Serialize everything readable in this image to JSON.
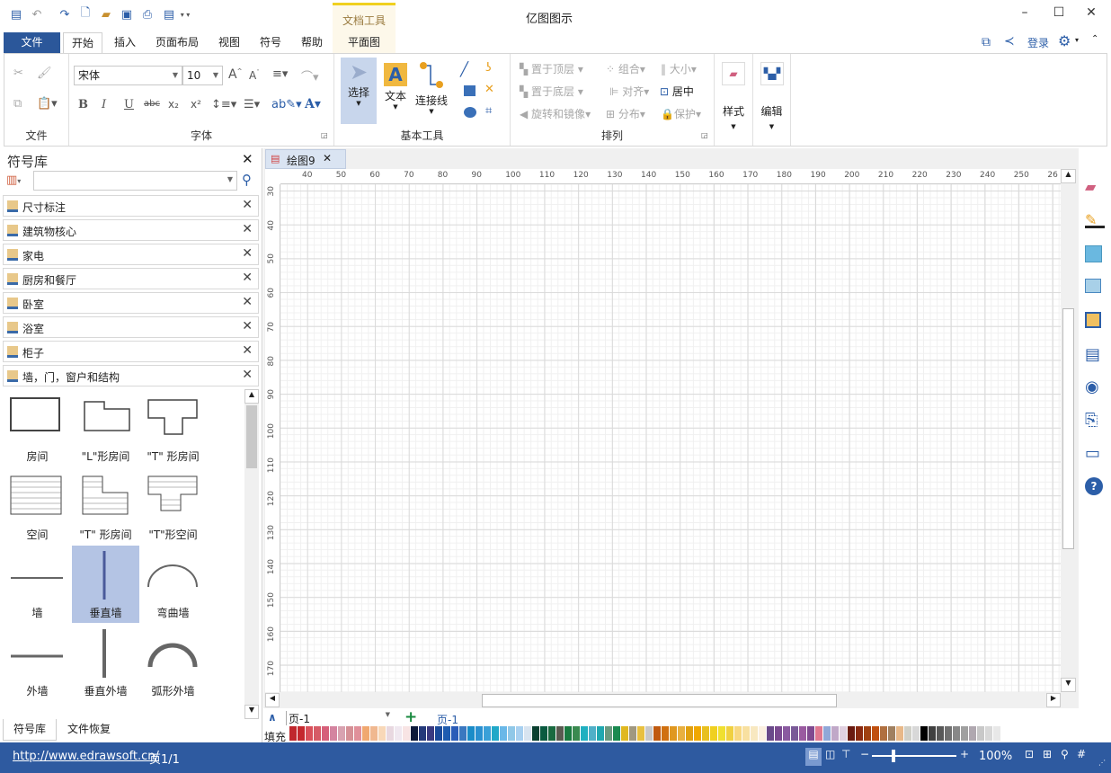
{
  "app": {
    "title": "亿图图示",
    "context_tab_group": "文档工具"
  },
  "window": {
    "minimize": "–",
    "maximize": "☐",
    "close": "✕"
  },
  "menu_tabs": [
    "文件",
    "开始",
    "插入",
    "页面布局",
    "视图",
    "符号",
    "帮助",
    "平面图"
  ],
  "header_right": {
    "login": "登录"
  },
  "ribbon": {
    "font_name": "宋体",
    "font_size": "10",
    "groups": {
      "file": "文件",
      "font": "字体",
      "basic_tools": "基本工具",
      "arrange": "排列"
    },
    "basic_tools": {
      "select": "选择",
      "text": "文本",
      "connector": "连接线"
    },
    "arrange": {
      "bring_front": "置于顶层",
      "group": "组合",
      "size": "大小",
      "send_back": "置于底层",
      "align": "对齐",
      "center": "居中",
      "rotate": "旋转和镜像",
      "distribute": "分布",
      "protect": "保护"
    },
    "style": "样式",
    "edit": "编辑"
  },
  "library": {
    "title": "符号库",
    "search_value": "",
    "items": [
      "尺寸标注",
      "建筑物核心",
      "家电",
      "厨房和餐厅",
      "卧室",
      "浴室",
      "柜子",
      "墙，门，窗户和结构"
    ],
    "shapes": [
      "房间",
      "\"L\"形房间",
      "\"T\" 形房间",
      "空间",
      "\"T\" 形房间",
      "\"T\"形空间",
      "墙",
      "垂直墙",
      "弯曲墙",
      "外墙",
      "垂直外墙",
      "弧形外墙"
    ],
    "selected_shape": "垂直墙",
    "bottom_tabs": [
      "符号库",
      "文件恢复"
    ]
  },
  "document_tab": {
    "name": "绘图9"
  },
  "ruler": {
    "top": [
      "40",
      "50",
      "60",
      "70",
      "80",
      "90",
      "100",
      "110",
      "120",
      "130",
      "140",
      "150",
      "160",
      "170",
      "180",
      "190",
      "200",
      "210",
      "220",
      "230",
      "240",
      "250",
      "26"
    ],
    "left": [
      "30",
      "40",
      "50",
      "60",
      "70",
      "80",
      "90",
      "100",
      "110",
      "120",
      "130",
      "140",
      "150",
      "160",
      "170"
    ]
  },
  "pages": {
    "selector": "页-1",
    "active_page": "页-1"
  },
  "palette": {
    "label": "填充",
    "colors": [
      "#c0272d",
      "#c4282e",
      "#d9505a",
      "#d65b66",
      "#d6607a",
      "#d484a0",
      "#d8a2b0",
      "#d59096",
      "#e0909a",
      "#f0a870",
      "#f0b890",
      "#f8d8b8",
      "#e8d8e0",
      "#f0e8f0",
      "#f8e4e4",
      "#0c1a3a",
      "#243a7a",
      "#3a3a80",
      "#1a4a9a",
      "#1e5cb0",
      "#2a5cb8",
      "#3a78c0",
      "#1a8cc8",
      "#2a90d0",
      "#3aa0d8",
      "#20a8c8",
      "#6ab8e8",
      "#90c8e8",
      "#a8d0f0",
      "#d8e4f0",
      "#0a4030",
      "#0a5a40",
      "#1a6a40",
      "#5a5a50",
      "#1a7a40",
      "#3a8a50",
      "#20b0c0",
      "#50b0c8",
      "#20a8b0",
      "#6a9a80",
      "#1a8a50",
      "#e0b820",
      "#a09880",
      "#e8c040",
      "#c8c8c8",
      "#c05a10",
      "#d07010",
      "#e09820",
      "#e8b040",
      "#e0a010",
      "#f0a800",
      "#e8c020",
      "#f0d020",
      "#f0e030",
      "#f0d040",
      "#f8d880",
      "#f8e0a0",
      "#f8e8c0",
      "#fbf0e0",
      "#6a4a8a",
      "#7a4a90",
      "#8a5aa0",
      "#7a5a98",
      "#9a5aa0",
      "#804a90",
      "#e07890",
      "#90a8d8",
      "#c0a8c8",
      "#e0d0e0",
      "#6a1a10",
      "#8a2a10",
      "#a04010",
      "#c05010",
      "#b07040",
      "#a08060",
      "#e8b888",
      "#d0d0c8",
      "#d8d8d8",
      "#000000",
      "#404040",
      "#585858",
      "#707070",
      "#888888",
      "#a0a0a0",
      "#b0a8b0",
      "#c8c8c8",
      "#d8d8d8",
      "#e8e8e8"
    ]
  },
  "status": {
    "url": "http://www.edrawsoft.cn/",
    "page_info": "页1/1",
    "zoom": "100%",
    "zoom_level_percent": 100
  },
  "colors": {
    "accent": "#2b579a",
    "status_bar": "#2e5aa0",
    "selected_shape_bg": "#b4c4e4"
  }
}
